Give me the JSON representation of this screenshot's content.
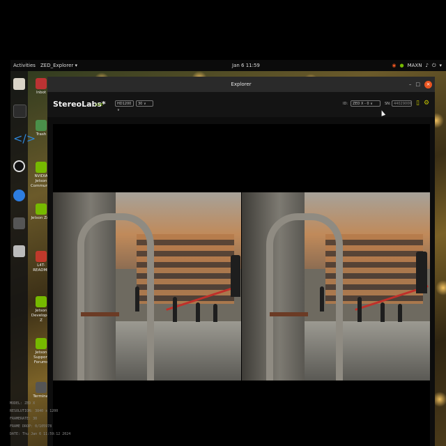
{
  "topbar": {
    "activities": "Activities",
    "app_menu": "ZED_Explorer ▾",
    "clock": "Jan 6 11:59",
    "tray_mode": "MAXN"
  },
  "desktop_icons": [
    {
      "label": "Inbot"
    },
    {
      "label": "Trash"
    },
    {
      "label": "NVIDIA Jetson Community"
    },
    {
      "label": "Jetson Zoo"
    },
    {
      "label": "L4T-README"
    },
    {
      "label": "Jetson Developer Z"
    },
    {
      "label": "Jetson Support Forums"
    },
    {
      "label": "Terminal"
    }
  ],
  "window": {
    "title": "Explorer"
  },
  "header": {
    "brand": "StereoLabs*",
    "live_label": "LIVE",
    "resolution_select": "HD1200 ∨",
    "fps_select": "30 ∨",
    "id_label": "ID:",
    "id_select": "ZED X - 0 ∨",
    "sn_label": "SN:",
    "sn_value": "44029006"
  },
  "stream_info": {
    "model": "MODEL: ZED X",
    "resolution": "RESOLUTION: 3840 x 1200",
    "framerate": "FRAMERATE: 30",
    "frame_drop": "FRAME DROP: 0/105978",
    "date": "DATE: Thu Jan 6 11:59:12 2024"
  },
  "colors": {
    "accent_green": "#76b900",
    "close_orange": "#e95420"
  }
}
